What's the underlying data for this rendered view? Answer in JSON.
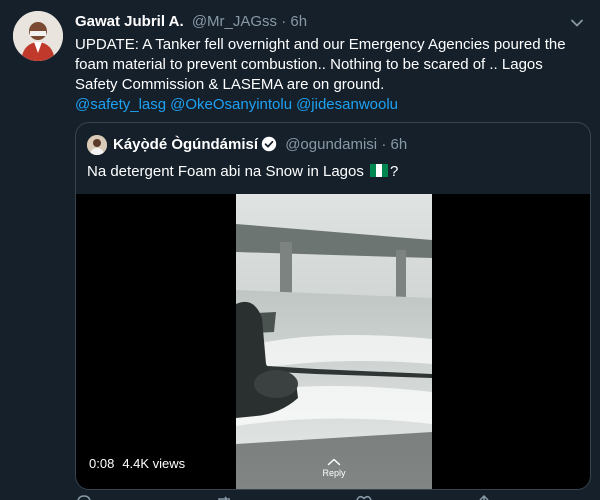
{
  "tweet": {
    "author_name": "Gawat Jubril A.",
    "author_handle": "@Mr_JAGss",
    "separator": "·",
    "timestamp": "6h",
    "text": "UPDATE: A Tanker fell overnight and our Emergency Agencies poured the foam material to prevent combustion.. Nothing to be scared of .. Lagos Safety Commission & LASEMA are on ground.",
    "mentions": [
      "@safety_lasg",
      "@OkeOsanyintolu",
      "@jidesanwoolu"
    ],
    "menu_icon": "chevron-down-icon"
  },
  "quoted_tweet": {
    "author_name": "Káyọ̀dé Ògúndámisí",
    "verified_icon": "verified-badge-icon",
    "author_handle": "@ogundamisi",
    "separator": "·",
    "timestamp": "6h",
    "text_before_flag": "Na detergent Foam abi na Snow in Lagos",
    "flag_icon": "nigeria-flag-icon",
    "text_after_flag": "?"
  },
  "video": {
    "duration": "0:08",
    "views": "4.4K views",
    "reply_hint": "Reply"
  },
  "actions": [
    "reply-icon",
    "retweet-icon",
    "like-icon",
    "share-icon"
  ],
  "colors": {
    "background": "#15202b",
    "text": "#ffffff",
    "secondary_text": "#8899a6",
    "link": "#1da1f2",
    "border": "#38444d"
  }
}
